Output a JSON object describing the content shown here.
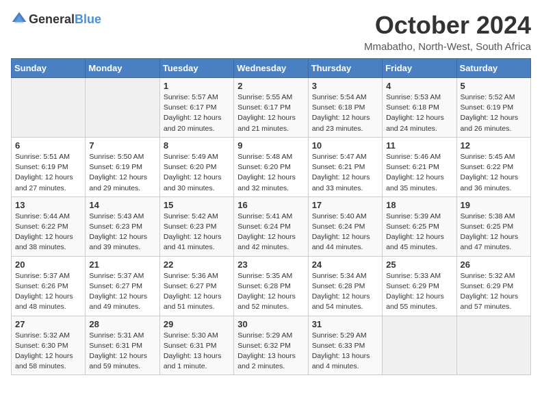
{
  "header": {
    "logo_general": "General",
    "logo_blue": "Blue",
    "month_title": "October 2024",
    "location": "Mmabatho, North-West, South Africa"
  },
  "days_of_week": [
    "Sunday",
    "Monday",
    "Tuesday",
    "Wednesday",
    "Thursday",
    "Friday",
    "Saturday"
  ],
  "weeks": [
    [
      {
        "day": "",
        "info": ""
      },
      {
        "day": "",
        "info": ""
      },
      {
        "day": "1",
        "info": "Sunrise: 5:57 AM\nSunset: 6:17 PM\nDaylight: 12 hours and 20 minutes."
      },
      {
        "day": "2",
        "info": "Sunrise: 5:55 AM\nSunset: 6:17 PM\nDaylight: 12 hours and 21 minutes."
      },
      {
        "day": "3",
        "info": "Sunrise: 5:54 AM\nSunset: 6:18 PM\nDaylight: 12 hours and 23 minutes."
      },
      {
        "day": "4",
        "info": "Sunrise: 5:53 AM\nSunset: 6:18 PM\nDaylight: 12 hours and 24 minutes."
      },
      {
        "day": "5",
        "info": "Sunrise: 5:52 AM\nSunset: 6:19 PM\nDaylight: 12 hours and 26 minutes."
      }
    ],
    [
      {
        "day": "6",
        "info": "Sunrise: 5:51 AM\nSunset: 6:19 PM\nDaylight: 12 hours and 27 minutes."
      },
      {
        "day": "7",
        "info": "Sunrise: 5:50 AM\nSunset: 6:19 PM\nDaylight: 12 hours and 29 minutes."
      },
      {
        "day": "8",
        "info": "Sunrise: 5:49 AM\nSunset: 6:20 PM\nDaylight: 12 hours and 30 minutes."
      },
      {
        "day": "9",
        "info": "Sunrise: 5:48 AM\nSunset: 6:20 PM\nDaylight: 12 hours and 32 minutes."
      },
      {
        "day": "10",
        "info": "Sunrise: 5:47 AM\nSunset: 6:21 PM\nDaylight: 12 hours and 33 minutes."
      },
      {
        "day": "11",
        "info": "Sunrise: 5:46 AM\nSunset: 6:21 PM\nDaylight: 12 hours and 35 minutes."
      },
      {
        "day": "12",
        "info": "Sunrise: 5:45 AM\nSunset: 6:22 PM\nDaylight: 12 hours and 36 minutes."
      }
    ],
    [
      {
        "day": "13",
        "info": "Sunrise: 5:44 AM\nSunset: 6:22 PM\nDaylight: 12 hours and 38 minutes."
      },
      {
        "day": "14",
        "info": "Sunrise: 5:43 AM\nSunset: 6:23 PM\nDaylight: 12 hours and 39 minutes."
      },
      {
        "day": "15",
        "info": "Sunrise: 5:42 AM\nSunset: 6:23 PM\nDaylight: 12 hours and 41 minutes."
      },
      {
        "day": "16",
        "info": "Sunrise: 5:41 AM\nSunset: 6:24 PM\nDaylight: 12 hours and 42 minutes."
      },
      {
        "day": "17",
        "info": "Sunrise: 5:40 AM\nSunset: 6:24 PM\nDaylight: 12 hours and 44 minutes."
      },
      {
        "day": "18",
        "info": "Sunrise: 5:39 AM\nSunset: 6:25 PM\nDaylight: 12 hours and 45 minutes."
      },
      {
        "day": "19",
        "info": "Sunrise: 5:38 AM\nSunset: 6:25 PM\nDaylight: 12 hours and 47 minutes."
      }
    ],
    [
      {
        "day": "20",
        "info": "Sunrise: 5:37 AM\nSunset: 6:26 PM\nDaylight: 12 hours and 48 minutes."
      },
      {
        "day": "21",
        "info": "Sunrise: 5:37 AM\nSunset: 6:27 PM\nDaylight: 12 hours and 49 minutes."
      },
      {
        "day": "22",
        "info": "Sunrise: 5:36 AM\nSunset: 6:27 PM\nDaylight: 12 hours and 51 minutes."
      },
      {
        "day": "23",
        "info": "Sunrise: 5:35 AM\nSunset: 6:28 PM\nDaylight: 12 hours and 52 minutes."
      },
      {
        "day": "24",
        "info": "Sunrise: 5:34 AM\nSunset: 6:28 PM\nDaylight: 12 hours and 54 minutes."
      },
      {
        "day": "25",
        "info": "Sunrise: 5:33 AM\nSunset: 6:29 PM\nDaylight: 12 hours and 55 minutes."
      },
      {
        "day": "26",
        "info": "Sunrise: 5:32 AM\nSunset: 6:29 PM\nDaylight: 12 hours and 57 minutes."
      }
    ],
    [
      {
        "day": "27",
        "info": "Sunrise: 5:32 AM\nSunset: 6:30 PM\nDaylight: 12 hours and 58 minutes."
      },
      {
        "day": "28",
        "info": "Sunrise: 5:31 AM\nSunset: 6:31 PM\nDaylight: 12 hours and 59 minutes."
      },
      {
        "day": "29",
        "info": "Sunrise: 5:30 AM\nSunset: 6:31 PM\nDaylight: 13 hours and 1 minute."
      },
      {
        "day": "30",
        "info": "Sunrise: 5:29 AM\nSunset: 6:32 PM\nDaylight: 13 hours and 2 minutes."
      },
      {
        "day": "31",
        "info": "Sunrise: 5:29 AM\nSunset: 6:33 PM\nDaylight: 13 hours and 4 minutes."
      },
      {
        "day": "",
        "info": ""
      },
      {
        "day": "",
        "info": ""
      }
    ]
  ]
}
